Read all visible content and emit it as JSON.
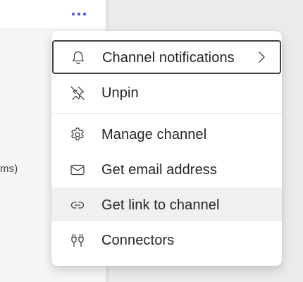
{
  "background": {
    "partial_text": "ms)"
  },
  "more_options_icon": "more-horizontal-icon",
  "menu": {
    "items": [
      {
        "label": "Channel notifications",
        "icon": "bell-icon",
        "has_submenu": true
      },
      {
        "label": "Unpin",
        "icon": "unpin-icon"
      },
      {
        "label": "Manage channel",
        "icon": "gear-icon"
      },
      {
        "label": "Get email address",
        "icon": "mail-icon"
      },
      {
        "label": "Get link to channel",
        "icon": "link-icon"
      },
      {
        "label": "Connectors",
        "icon": "connectors-icon"
      }
    ]
  },
  "colors": {
    "accent": "#5b5fc7",
    "text": "#242424",
    "hover": "#f0f0f0"
  }
}
